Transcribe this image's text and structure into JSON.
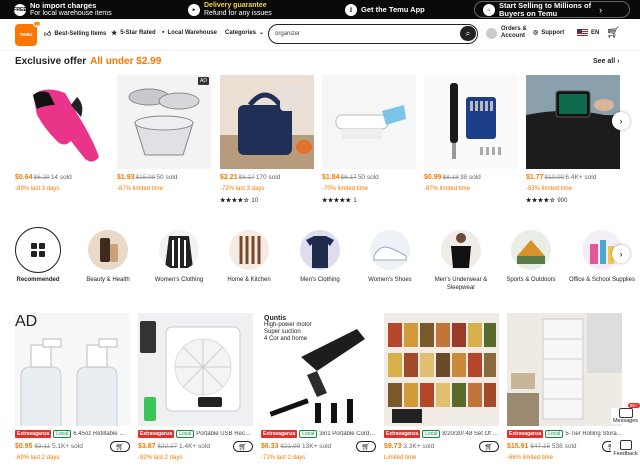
{
  "promo": {
    "item1": {
      "icon": "FREE",
      "title": "No import charges",
      "sub": "For local warehouse items"
    },
    "item2": {
      "title": "Delivery guarantee",
      "sub": "Refund for any issues"
    },
    "item3": {
      "title": "Get the Temu App"
    },
    "item4": {
      "line1": "Start Selling to Millions of",
      "line2": "Buyers on Temu"
    }
  },
  "header": {
    "logo_text": "TEMU",
    "logo_badge": "US",
    "nav": [
      "Best-Selling Items",
      "5-Star Rated",
      "Local Warehouse",
      "Categories"
    ],
    "search_value": "organizer",
    "account_line1": "Orders &",
    "account_line2": "Account",
    "support": "Support",
    "lang": "EN"
  },
  "offer": {
    "title": "Exclusive offer",
    "subtitle": "All under $2.99",
    "see_all": "See all",
    "products": [
      {
        "now": "$0.64",
        "was": "$6.29",
        "sold": "14 sold",
        "disc": "-89% last 3 days",
        "stars": "",
        "reviews": "",
        "ad": ""
      },
      {
        "now": "$1.93",
        "was": "$15.98",
        "sold": "50 sold",
        "disc": "-87% limited time",
        "stars": "",
        "reviews": "",
        "ad": "AD"
      },
      {
        "now": "$2.21",
        "was": "$8.17",
        "sold": "170 sold",
        "disc": "-72% last 3 days",
        "stars": "★★★★☆",
        "reviews": "10",
        "ad": ""
      },
      {
        "now": "$1.84",
        "was": "$6.17",
        "sold": "50 sold",
        "disc": "-70% limited time",
        "stars": "★★★★★",
        "reviews": "1",
        "ad": ""
      },
      {
        "now": "$0.99",
        "was": "$8.18",
        "sold": "38 sold",
        "disc": "-87% limited time",
        "stars": "",
        "reviews": "",
        "ad": ""
      },
      {
        "now": "$1.77",
        "was": "$10.99",
        "sold": "6.4K+ sold",
        "disc": "-83% limited time",
        "stars": "★★★★☆",
        "reviews": "900",
        "ad": ""
      }
    ]
  },
  "categories": [
    {
      "label": "Recommended"
    },
    {
      "label": "Beauty & Health"
    },
    {
      "label": "Women's Clothing"
    },
    {
      "label": "Home & Kitchen"
    },
    {
      "label": "Men's Clothing"
    },
    {
      "label": "Women's Shoes"
    },
    {
      "label": "Men's Underwear & Sleepwear"
    },
    {
      "label": "Sports & Outdoors"
    },
    {
      "label": "Office & School Supplies"
    }
  ],
  "products2": [
    {
      "name": "6.45oz Refillable Mis...",
      "now": "$0.95",
      "was": "$3.11",
      "sold": "5.1K+ sold",
      "disc": "-69% last 2 days",
      "ad": "AD"
    },
    {
      "name": "Portable USB Rechar...",
      "now": "$3.87",
      "was": "$22.27",
      "sold": "1.4K+ sold",
      "disc": "-82% last 2 days",
      "ad": ""
    },
    {
      "name": "3in1 Portable Cordle...",
      "now": "$6.33",
      "was": "$21.99",
      "sold": "13K+ sold",
      "disc": "-71% last 2 days",
      "ad": ""
    },
    {
      "name": "8/20/30/ 48 Set Of A...",
      "now": "$9.73",
      "was": "",
      "sold": "3.3K+ sold",
      "disc": "Limited time",
      "ad": ""
    },
    {
      "name": "5-Tier Rolling Stora...",
      "now": "$15.91",
      "was": "$47.15",
      "sold": "538 sold",
      "disc": "-66% limited time",
      "ad": ""
    }
  ],
  "tag_extravaganza": "Extravaganza",
  "tag_local": "Local",
  "image_text": {
    "quntis": "Quntis",
    "f1": "High-power motor",
    "f2": "Super suction",
    "f3": "4 Cor and home"
  },
  "side": {
    "messages": "Messages",
    "messages_badge": "99+",
    "feedback": "Feedback"
  }
}
